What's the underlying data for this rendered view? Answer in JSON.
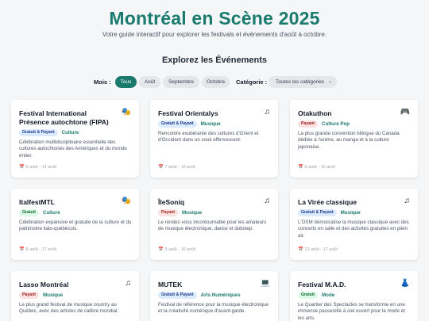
{
  "header": {
    "title": "Montréal en Scène 2025",
    "subtitle": "Votre guide interactif pour explorer les festivals et événements d'août à octobre."
  },
  "explore": {
    "heading": "Explorez les Événements",
    "month_label": "Mois :",
    "months": [
      "Tous",
      "Août",
      "Septembre",
      "Octobre"
    ],
    "active_month": "Tous",
    "category_label": "Catégorie :",
    "category_selected": "Toutes les catégories"
  },
  "colors": {
    "accent": "#1b7a6e",
    "badge_gratuit_payant": "#dbeafe",
    "badge_payant": "#fee2e2",
    "badge_gratuit": "#dcfce7"
  },
  "events": [
    {
      "title": "Festival International Présence autochtone (FIPA)",
      "icon": "theater-masks-icon",
      "glyph": "🎭",
      "price": "Gratuit & Payant",
      "category": "Culture",
      "description": "Célébration multidisciplinaire essentielle des cultures autochtones des Amériques et du monde entier.",
      "date": "5 août - 14 août"
    },
    {
      "title": "Festival Orientalys",
      "icon": "music-note-icon",
      "glyph": "♫",
      "price": "Gratuit & Payant",
      "category": "Musique",
      "description": "Rencontre exubérante des cultures d'Orient et d'Occident dans un souk effervescent.",
      "date": "7 août - 10 août"
    },
    {
      "title": "Otakuthon",
      "icon": "game-controller-icon",
      "glyph": "🎮",
      "price": "Payant",
      "category": "Culture Pop",
      "description": "La plus grande convention bilingue du Canada dédiée à l'anime, au manga et à la culture japonaise.",
      "date": "8 août - 10 août"
    },
    {
      "title": "ItalfestMTL",
      "icon": "theater-masks-icon",
      "glyph": "🎭",
      "price": "Gratuit",
      "category": "Culture",
      "description": "Célébration expansive et gratuite de la culture et du patrimoine italo-québécois.",
      "date": "8 août - 17 août"
    },
    {
      "title": "ÎleSoniq",
      "icon": "music-note-icon",
      "glyph": "♫",
      "price": "Payant",
      "category": "Musique",
      "description": "Le rendez-vous incontournable pour les amateurs de musique électronique, dance et dubstep.",
      "date": "9 août - 10 août"
    },
    {
      "title": "La Virée classique",
      "icon": "music-note-icon",
      "glyph": "♫",
      "price": "Gratuit & Payant",
      "category": "Musique",
      "description": "L'OSM démocratise la musique classique avec des concerts en salle et des activités gratuites en plein air.",
      "date": "13 août - 17 août"
    },
    {
      "title": "Lasso Montréal",
      "icon": "music-note-icon",
      "glyph": "♫",
      "price": "Payant",
      "category": "Musique",
      "description": "Le plus grand festival de musique country au Québec, avec des artistes de calibre mondial.",
      "date": ""
    },
    {
      "title": "MUTEK",
      "icon": "laptop-icon",
      "glyph": "💻",
      "price": "Gratuit & Payant",
      "category": "Arts Numériques",
      "description": "Festival de référence pour la musique électronique et la créativité numérique d'avant-garde.",
      "date": ""
    },
    {
      "title": "Festival M.A.D.",
      "icon": "dress-icon",
      "glyph": "👗",
      "price": "Gratuit",
      "category": "Mode",
      "description": "Le Quartier des Spectacles se transforme en une immense passerelle à ciel ouvert pour la mode et les arts.",
      "date": ""
    }
  ]
}
